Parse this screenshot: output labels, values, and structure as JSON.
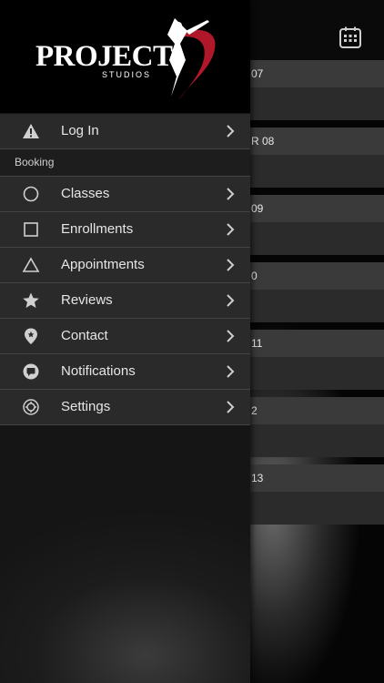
{
  "brand": {
    "name": "PROJECT",
    "subtitle": "STUDIOS"
  },
  "header": {
    "calendar_icon": "calendar-icon"
  },
  "schedule_rows": [
    {
      "label": "07"
    },
    {
      "label": "R 08"
    },
    {
      "label": "09"
    },
    {
      "label": "0"
    },
    {
      "label": "11"
    },
    {
      "label": "2"
    },
    {
      "label": "13"
    }
  ],
  "menu": {
    "login": {
      "label": "Log In",
      "icon": "warning-icon"
    },
    "section_booking": "Booking",
    "items": [
      {
        "label": "Classes",
        "icon": "circle-icon"
      },
      {
        "label": "Enrollments",
        "icon": "square-icon"
      },
      {
        "label": "Appointments",
        "icon": "triangle-icon"
      },
      {
        "label": "Reviews",
        "icon": "star-icon"
      },
      {
        "label": "Contact",
        "icon": "location-pin-icon"
      },
      {
        "label": "Notifications",
        "icon": "chat-bubble-icon"
      },
      {
        "label": "Settings",
        "icon": "gear-icon"
      }
    ]
  },
  "colors": {
    "drawer_bg": "#2a2a2a",
    "logo_accent": "#b0182a",
    "text": "#e6e6e6"
  }
}
